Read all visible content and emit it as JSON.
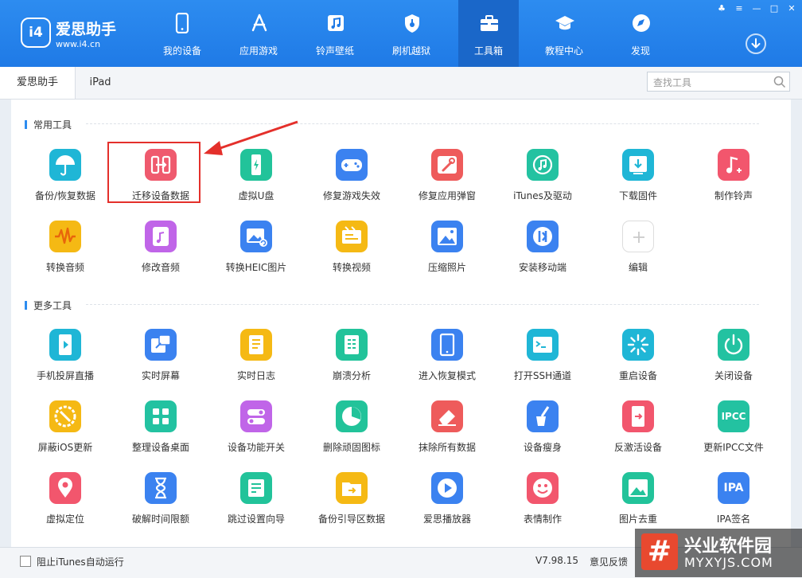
{
  "app": {
    "name": "爱思助手",
    "url": "www.i4.cn"
  },
  "nav": [
    {
      "label": "我的设备",
      "icon": "phone-icon"
    },
    {
      "label": "应用游戏",
      "icon": "app-store-icon"
    },
    {
      "label": "铃声壁纸",
      "icon": "music-icon"
    },
    {
      "label": "刷机越狱",
      "icon": "shield-icon"
    },
    {
      "label": "工具箱",
      "icon": "toolbox-icon",
      "active": true
    },
    {
      "label": "教程中心",
      "icon": "graduation-cap-icon"
    },
    {
      "label": "发现",
      "icon": "compass-icon"
    }
  ],
  "tabs": [
    {
      "label": "爱思助手",
      "active": true
    },
    {
      "label": "iPad"
    }
  ],
  "search": {
    "placeholder": "查找工具",
    "value": ""
  },
  "sections": {
    "common": "常用工具",
    "more": "更多工具"
  },
  "common_tools": [
    {
      "label": "备份/恢复数据",
      "icon": "umbrella-icon",
      "color": "#1fb6d6"
    },
    {
      "label": "迁移设备数据",
      "icon": "migrate-icon",
      "color": "#ef5a6e",
      "highlighted": true
    },
    {
      "label": "虚拟U盘",
      "icon": "usb-drive-icon",
      "color": "#22c39a"
    },
    {
      "label": "修复游戏失效",
      "icon": "gamepad-icon",
      "color": "#3b82f0"
    },
    {
      "label": "修复应用弹窗",
      "icon": "wrench-icon",
      "color": "#ee5b5b"
    },
    {
      "label": "iTunes及驱动",
      "icon": "itunes-icon",
      "color": "#23c2a1"
    },
    {
      "label": "下载固件",
      "icon": "download-firmware-icon",
      "color": "#1fb6d6"
    },
    {
      "label": "制作铃声",
      "icon": "ringtone-icon",
      "color": "#f2566d"
    },
    {
      "label": "转换音频",
      "icon": "waveform-icon",
      "color": "#f5b914"
    },
    {
      "label": "修改音频",
      "icon": "audio-edit-icon",
      "color": "#c065e8"
    },
    {
      "label": "转换HEIC图片",
      "icon": "image-convert-icon",
      "color": "#3b82f0"
    },
    {
      "label": "转换视频",
      "icon": "video-convert-icon",
      "color": "#f5b914"
    },
    {
      "label": "压缩照片",
      "icon": "photo-compress-icon",
      "color": "#3b82f0"
    },
    {
      "label": "安装移动端",
      "icon": "i4-app-icon",
      "color": "#3b82f0"
    },
    {
      "label": "编辑",
      "icon": "plus-icon",
      "color": "#ffffff"
    }
  ],
  "more_tools": [
    {
      "label": "手机投屏直播",
      "icon": "screen-mirror-icon",
      "color": "#1fb6d6"
    },
    {
      "label": "实时屏幕",
      "icon": "realtime-screen-icon",
      "color": "#3b82f0"
    },
    {
      "label": "实时日志",
      "icon": "log-icon",
      "color": "#f5b914"
    },
    {
      "label": "崩溃分析",
      "icon": "crash-report-icon",
      "color": "#22c39a"
    },
    {
      "label": "进入恢复模式",
      "icon": "recovery-mode-icon",
      "color": "#3b82f0"
    },
    {
      "label": "打开SSH通道",
      "icon": "terminal-icon",
      "color": "#1fb6d6"
    },
    {
      "label": "重启设备",
      "icon": "restart-icon",
      "color": "#1fb6d6"
    },
    {
      "label": "关闭设备",
      "icon": "power-icon",
      "color": "#23c2a1"
    },
    {
      "label": "屏蔽iOS更新",
      "icon": "block-update-icon",
      "color": "#f5b914"
    },
    {
      "label": "整理设备桌面",
      "icon": "grid-icon",
      "color": "#23c2a1"
    },
    {
      "label": "设备功能开关",
      "icon": "toggle-icon",
      "color": "#c065e8"
    },
    {
      "label": "删除顽固图标",
      "icon": "pie-icon",
      "color": "#22c39a"
    },
    {
      "label": "抹除所有数据",
      "icon": "eraser-icon",
      "color": "#ee5b5b"
    },
    {
      "label": "设备瘦身",
      "icon": "broom-icon",
      "color": "#3b82f0"
    },
    {
      "label": "反激活设备",
      "icon": "deactivate-icon",
      "color": "#f2566d"
    },
    {
      "label": "更新IPCC文件",
      "icon": "ipcc-icon",
      "color": "#23c2a1",
      "text": "IPCC"
    },
    {
      "label": "虚拟定位",
      "icon": "location-pin-icon",
      "color": "#f2566d"
    },
    {
      "label": "破解时间限额",
      "icon": "hourglass-icon",
      "color": "#3b82f0"
    },
    {
      "label": "跳过设置向导",
      "icon": "skip-wizard-icon",
      "color": "#22c39a"
    },
    {
      "label": "备份引导区数据",
      "icon": "backup-folder-icon",
      "color": "#f5b914"
    },
    {
      "label": "爱思播放器",
      "icon": "play-icon",
      "color": "#3b82f0"
    },
    {
      "label": "表情制作",
      "icon": "emoji-icon",
      "color": "#f2566d"
    },
    {
      "label": "图片去重",
      "icon": "image-dedupe-icon",
      "color": "#22c39a"
    },
    {
      "label": "IPA签名",
      "icon": "ipa-icon",
      "color": "#3b82f0",
      "text": "IPA"
    }
  ],
  "footer": {
    "checkbox_label": "阻止iTunes自动运行",
    "version": "V7.98.15",
    "feedback": "意见反馈"
  },
  "watermark": {
    "title": "兴业软件园",
    "url": "MYXYJS.COM"
  }
}
